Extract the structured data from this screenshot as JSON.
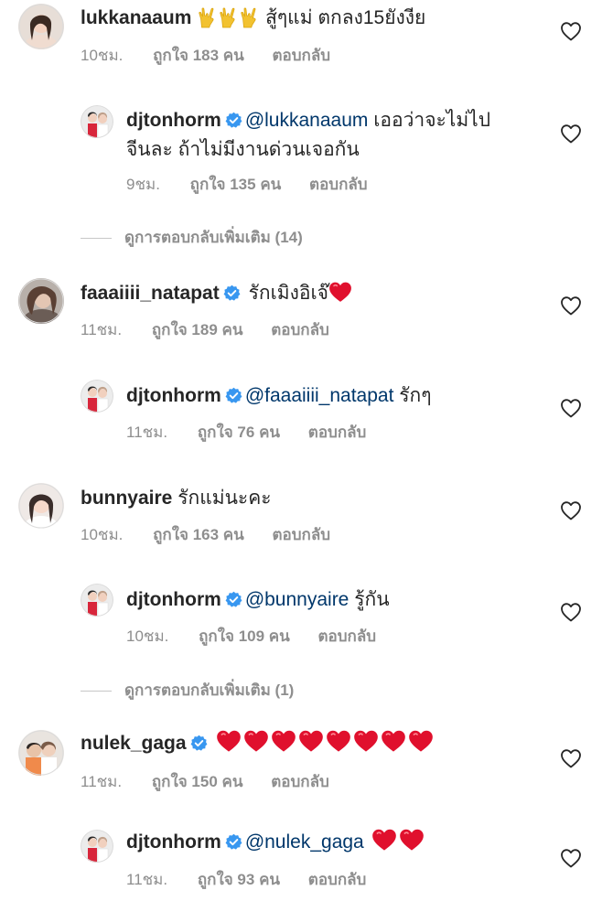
{
  "comments": [
    {
      "username": "lukkanaaum",
      "text": " สู้ๆแม่ ตกลง15ยังงีย",
      "time": "10ชม.",
      "likes": "ถูกใจ 183 คน",
      "reply": "ตอบกลับ"
    },
    {
      "username": "djtonhorm",
      "mention": "@lukkanaaum",
      "text": " เออว่าจะไม่ไป",
      "text2": "จีนละ ถ้าไม่มีงานด่วนเจอกัน",
      "time": "9ชม.",
      "likes": "ถูกใจ 135 คน",
      "reply": "ตอบกลับ"
    },
    {
      "view_more": "ดูการตอบกลับเพิ่มเติม (14)"
    },
    {
      "username": "faaaiiii_natapat",
      "text": " รักเมิงอิเจ๊",
      "time": "11ชม.",
      "likes": "ถูกใจ 189 คน",
      "reply": "ตอบกลับ"
    },
    {
      "username": "djtonhorm",
      "mention": "@faaaiiii_natapat",
      "text": " รักๆ",
      "time": "11ชม.",
      "likes": "ถูกใจ 76 คน",
      "reply": "ตอบกลับ"
    },
    {
      "username": "bunnyaire",
      "text": " รักแม่นะคะ",
      "time": "10ชม.",
      "likes": "ถูกใจ 163 คน",
      "reply": "ตอบกลับ"
    },
    {
      "username": "djtonhorm",
      "mention": "@bunnyaire",
      "text": " รู้กัน",
      "time": "10ชม.",
      "likes": "ถูกใจ 109 คน",
      "reply": "ตอบกลับ"
    },
    {
      "view_more": "ดูการตอบกลับเพิ่มเติม (1)"
    },
    {
      "username": "nulek_gaga",
      "text": "",
      "time": "11ชม.",
      "likes": "ถูกใจ 150 คน",
      "reply": "ตอบกลับ"
    },
    {
      "username": "djtonhorm",
      "mention": "@nulek_gaga",
      "text": "",
      "time": "11ชม.",
      "likes": "ถูกใจ 93 คน",
      "reply": "ตอบกลับ"
    }
  ],
  "colors": {
    "text": "#262626",
    "meta": "#8e8e8e",
    "mention": "#00376b",
    "verified": "#3897f0",
    "heart": "#e0102d"
  }
}
